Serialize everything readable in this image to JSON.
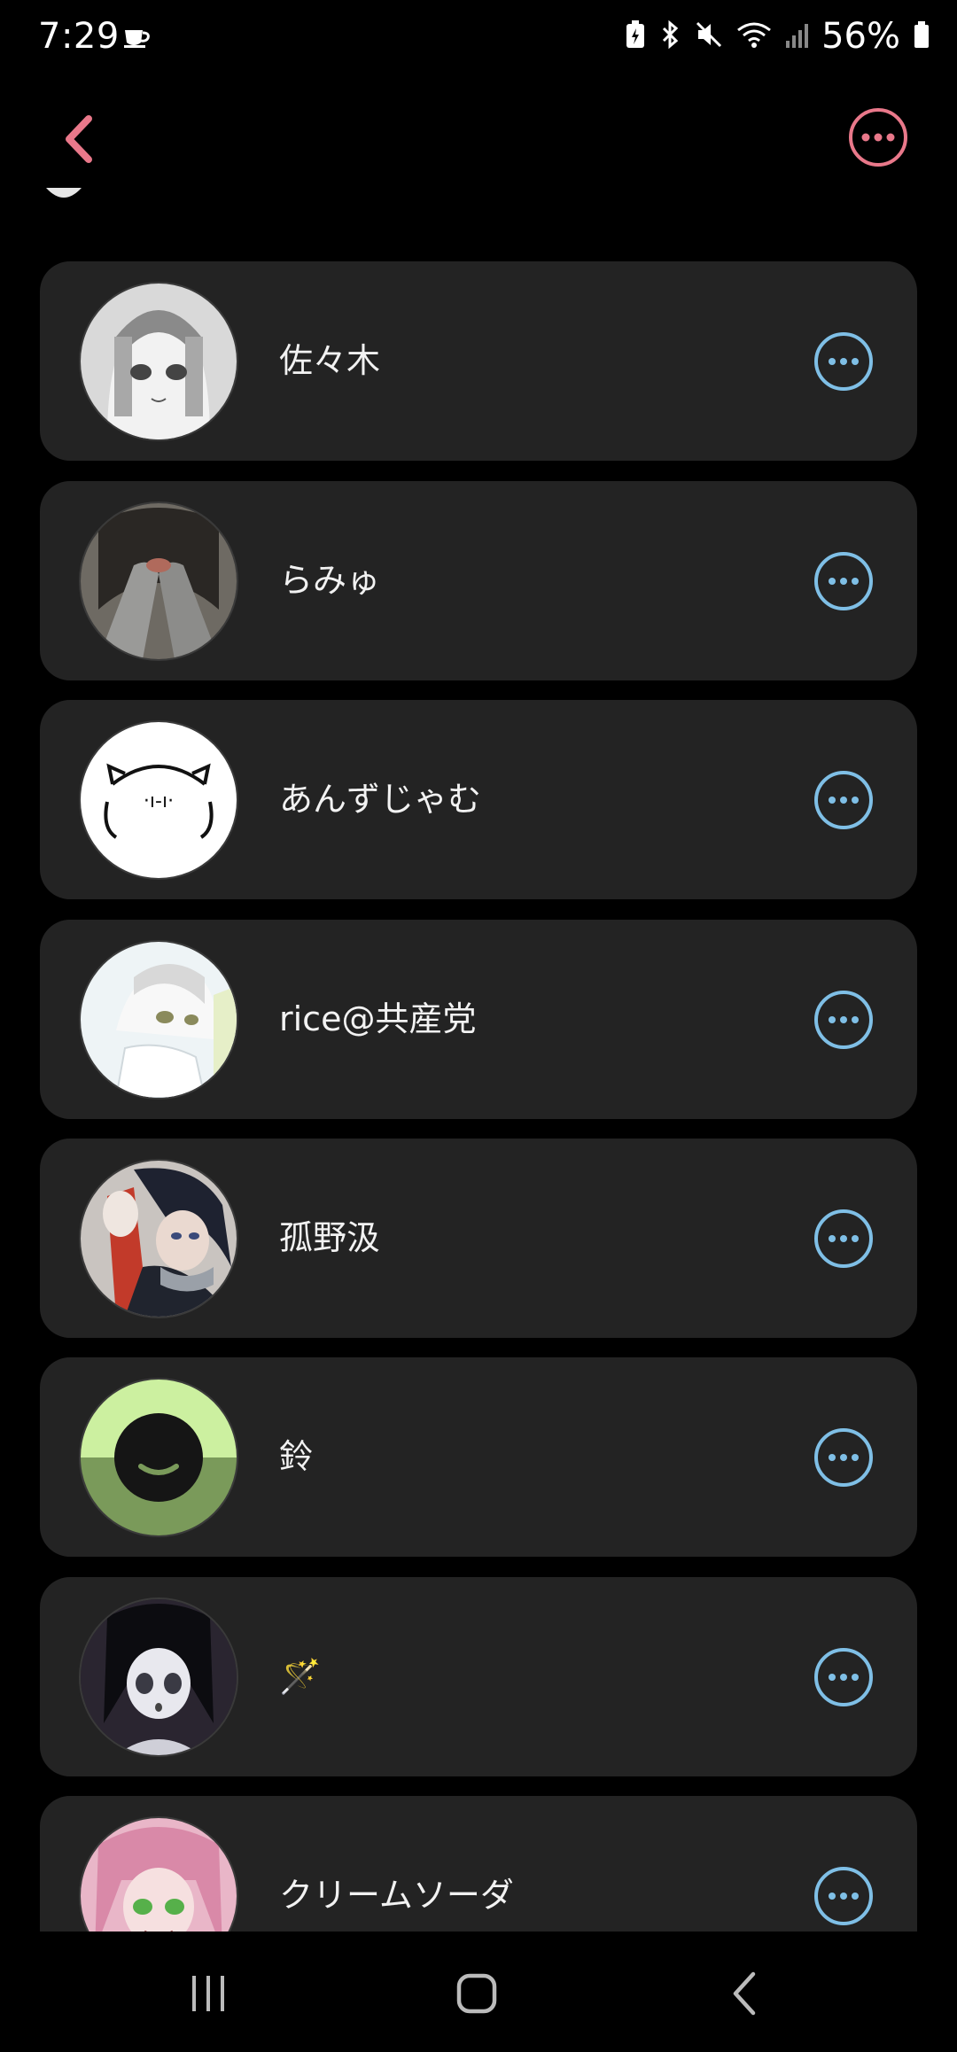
{
  "status": {
    "time": "7:29",
    "battery": "56%"
  },
  "colors": {
    "accent_pink": "#e9788a",
    "accent_blue": "#7fbfe6",
    "card_bg": "#232323"
  },
  "users": [
    {
      "name": "佐々木",
      "avatar": "manga-girl-avatar"
    },
    {
      "name": "らみゅ",
      "avatar": "sleeves-photo-avatar"
    },
    {
      "name": "あんずじゃむ",
      "avatar": "cat-face-drawing-avatar"
    },
    {
      "name": "rice@共産党",
      "avatar": "white-hair-anime-avatar"
    },
    {
      "name": "孤野汲",
      "avatar": "dark-hair-anime-avatar"
    },
    {
      "name": "鈴",
      "avatar": "green-smile-avatar"
    },
    {
      "name": "🪄",
      "avatar": "anime-girl-bw-avatar"
    },
    {
      "name": "クリームソーダ",
      "avatar": "pink-hair-anime-avatar"
    }
  ],
  "icons": {
    "back": "chevron-left-icon",
    "menu": "more-horizontal-circle-icon",
    "row_more": "more-horizontal-circle-icon",
    "nav_recents": "recents-icon",
    "nav_home": "home-icon",
    "nav_back": "back-icon"
  }
}
